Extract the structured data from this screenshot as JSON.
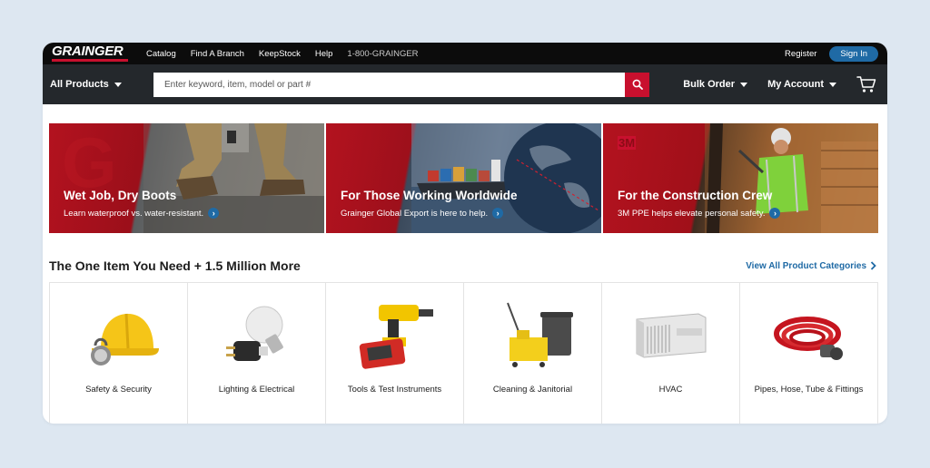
{
  "topbar": {
    "logo_text": "GRAINGER",
    "nav": [
      "Catalog",
      "Find A Branch",
      "KeepStock",
      "Help"
    ],
    "phone": "1-800-GRAINGER",
    "register": "Register",
    "signin": "Sign In"
  },
  "searchbar": {
    "all_products": "All Products",
    "placeholder": "Enter keyword, item, model or part #",
    "bulk_order": "Bulk Order",
    "my_account": "My Account"
  },
  "banners": [
    {
      "title": "Wet Job, Dry Boots",
      "subtitle": "Learn waterproof vs. water-resistant."
    },
    {
      "title": "For Those Working Worldwide",
      "subtitle": "Grainger Global Export is here to help."
    },
    {
      "title": "For the Construction Crew",
      "subtitle": "3M PPE helps elevate personal safety.",
      "brand": "3M"
    }
  ],
  "categories": {
    "heading": "The One Item You Need + 1.5 Million More",
    "view_all": "View All Product Categories",
    "items": [
      {
        "label": "Safety & Security"
      },
      {
        "label": "Lighting & Electrical"
      },
      {
        "label": "Tools & Test Instruments"
      },
      {
        "label": "Cleaning & Janitorial"
      },
      {
        "label": "HVAC"
      },
      {
        "label": "Pipes, Hose, Tube & Fittings"
      }
    ]
  },
  "colors": {
    "brand_red": "#c8102e",
    "link_blue": "#1f6aa5",
    "topbar": "#0c0c0c",
    "searchbar": "#24282c",
    "page_bg": "#dde7f1"
  },
  "icons": [
    "search-icon",
    "cart-icon",
    "chevron-right-icon",
    "caret-down-icon"
  ]
}
